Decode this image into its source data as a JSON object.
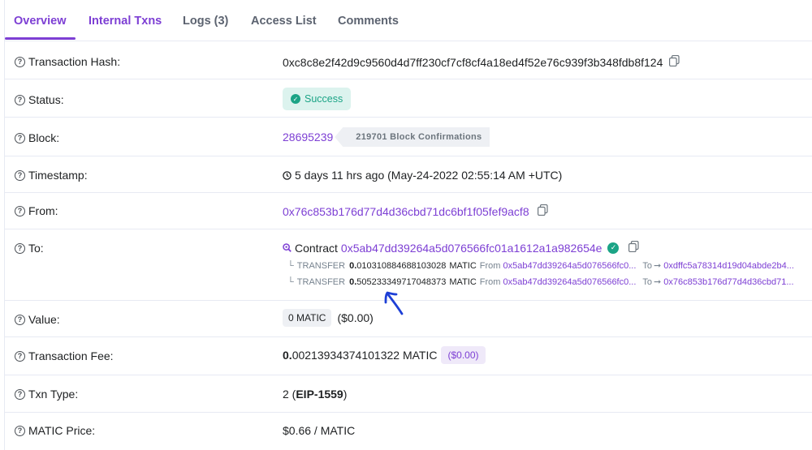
{
  "tabs": [
    {
      "label": "Overview",
      "active": true
    },
    {
      "label": "Internal Txns"
    },
    {
      "label": "Logs (3)"
    },
    {
      "label": "Access List"
    },
    {
      "label": "Comments"
    }
  ],
  "rows": {
    "tx_hash": {
      "label": "Transaction Hash:",
      "value": "0xc8c8e2f42d9c9560d4d7ff230cf7cf8cf4a18ed4f52e76c939f3b348fdb8f124"
    },
    "status": {
      "label": "Status:",
      "value": "Success"
    },
    "block": {
      "label": "Block:",
      "value": "28695239",
      "confirmations": "219701 Block Confirmations"
    },
    "timestamp": {
      "label": "Timestamp:",
      "value": "5 days 11 hrs ago (May-24-2022 02:55:14 AM +UTC)"
    },
    "from": {
      "label": "From:",
      "value": "0x76c853b176d77d4d36cbd71dc6bf1f05fef9acf8"
    },
    "to": {
      "label": "To:",
      "contract_prefix": "Contract",
      "contract": "0x5ab47dd39264a5d076566fc01a1612a1a982654e",
      "transfers": [
        {
          "prefix": "TRANSFER",
          "amount_bold": "0.",
          "amount_rest": "010310884688103028",
          "unit": "MATIC",
          "from_label": "From",
          "from": "0x5ab47dd39264a5d076566fc0...",
          "to_label": "To",
          "to": "0xdffc5a78314d19d04abde2b4..."
        },
        {
          "prefix": "TRANSFER",
          "amount_bold": "0.",
          "amount_rest": "505233349717048373",
          "unit": "MATIC",
          "from_label": "From",
          "from": "0x5ab47dd39264a5d076566fc0...",
          "to_label": "To",
          "to": "0x76c853b176d77d4d36cbd71..."
        }
      ]
    },
    "value": {
      "label": "Value:",
      "chip": "0 MATIC",
      "usd": "($0.00)"
    },
    "fee": {
      "label": "Transaction Fee:",
      "value_bold": "0.",
      "value_rest": "00213934374101322 MATIC",
      "usd": "($0.00)"
    },
    "txn_type": {
      "label": "Txn Type:",
      "pre": "2 (",
      "bold": "EIP-1559",
      "post": ")"
    },
    "price": {
      "label": "MATIC Price:",
      "value": "$0.66 / MATIC"
    }
  },
  "colors": {
    "accent": "#7d3fd4",
    "success": "#1ba486",
    "annotation": "#1d3fd6"
  }
}
